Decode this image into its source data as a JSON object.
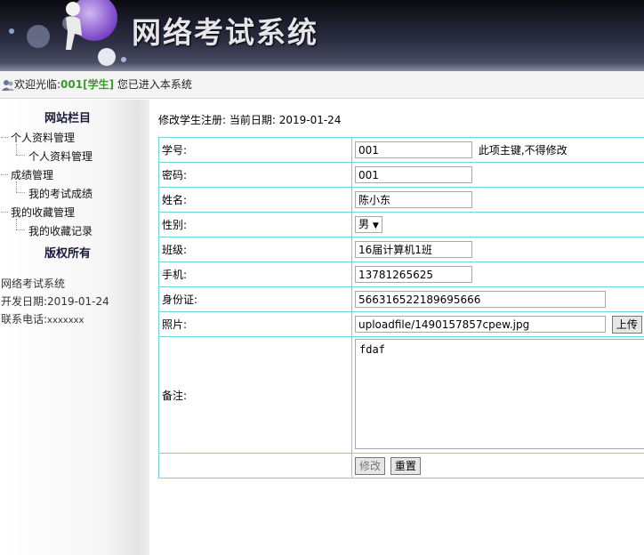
{
  "header": {
    "title": "网络考试系统"
  },
  "welcome": {
    "prefix": "欢迎光临:",
    "user": "001[学生]",
    "suffix": " 您已进入本系统"
  },
  "sidebar": {
    "heading": "网站栏目",
    "groups": [
      {
        "label": "个人资料管理",
        "children": [
          "个人资料管理"
        ]
      },
      {
        "label": "成绩管理",
        "children": [
          "我的考试成绩"
        ]
      },
      {
        "label": "我的收藏管理",
        "children": [
          "我的收藏记录"
        ]
      }
    ],
    "copyright": "版权所有",
    "info": {
      "system": "网络考试系统",
      "dev_date_label": "开发日期:",
      "dev_date": "2019-01-24",
      "phone_label": "联系电话:",
      "phone": "xxxxxxx"
    }
  },
  "main": {
    "caption": "修改学生注册:  当前日期: 2019-01-24",
    "fields": {
      "student_id": {
        "label": "学号:",
        "value": "001",
        "note": "此项主键,不得修改"
      },
      "password": {
        "label": "密码:",
        "value": "001"
      },
      "name": {
        "label": "姓名:",
        "value": "陈小东"
      },
      "gender": {
        "label": "性别:",
        "value": "男"
      },
      "class": {
        "label": "班级:",
        "value": "16届计算机1班"
      },
      "phone": {
        "label": "手机:",
        "value": "13781265625"
      },
      "id_card": {
        "label": "身份证:",
        "value": "566316522189695666"
      },
      "photo": {
        "label": "照片:",
        "value": "uploadfile/1490157857cpew.jpg",
        "upload_label": "上传"
      },
      "remark": {
        "label": "备注:",
        "value": "fdaf"
      }
    },
    "buttons": {
      "submit": "修改",
      "reset": "重置"
    }
  }
}
